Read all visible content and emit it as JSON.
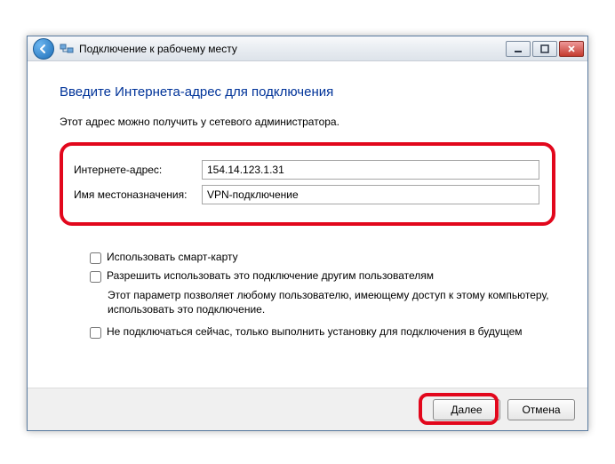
{
  "titlebar": {
    "text": "Подключение к рабочему месту"
  },
  "heading": "Введите Интернета-адрес для подключения",
  "subtext": "Этот адрес можно получить у сетевого администратора.",
  "fields": {
    "address_label": "Интернете-адрес:",
    "address_value": "154.14.123.1.31",
    "destination_label": "Имя местоназначения:",
    "destination_value": "VPN-подключение"
  },
  "checks": {
    "smartcard": "Использовать смарт-карту",
    "allow_others": "Разрешить использовать это подключение другим пользователям",
    "allow_others_desc": "Этот параметр позволяет любому пользователю, имеющему доступ к этому компьютеру, использовать это подключение.",
    "setup_only": "Не подключаться сейчас, только выполнить установку для подключения в будущем"
  },
  "buttons": {
    "next": "Далее",
    "cancel": "Отмена"
  }
}
